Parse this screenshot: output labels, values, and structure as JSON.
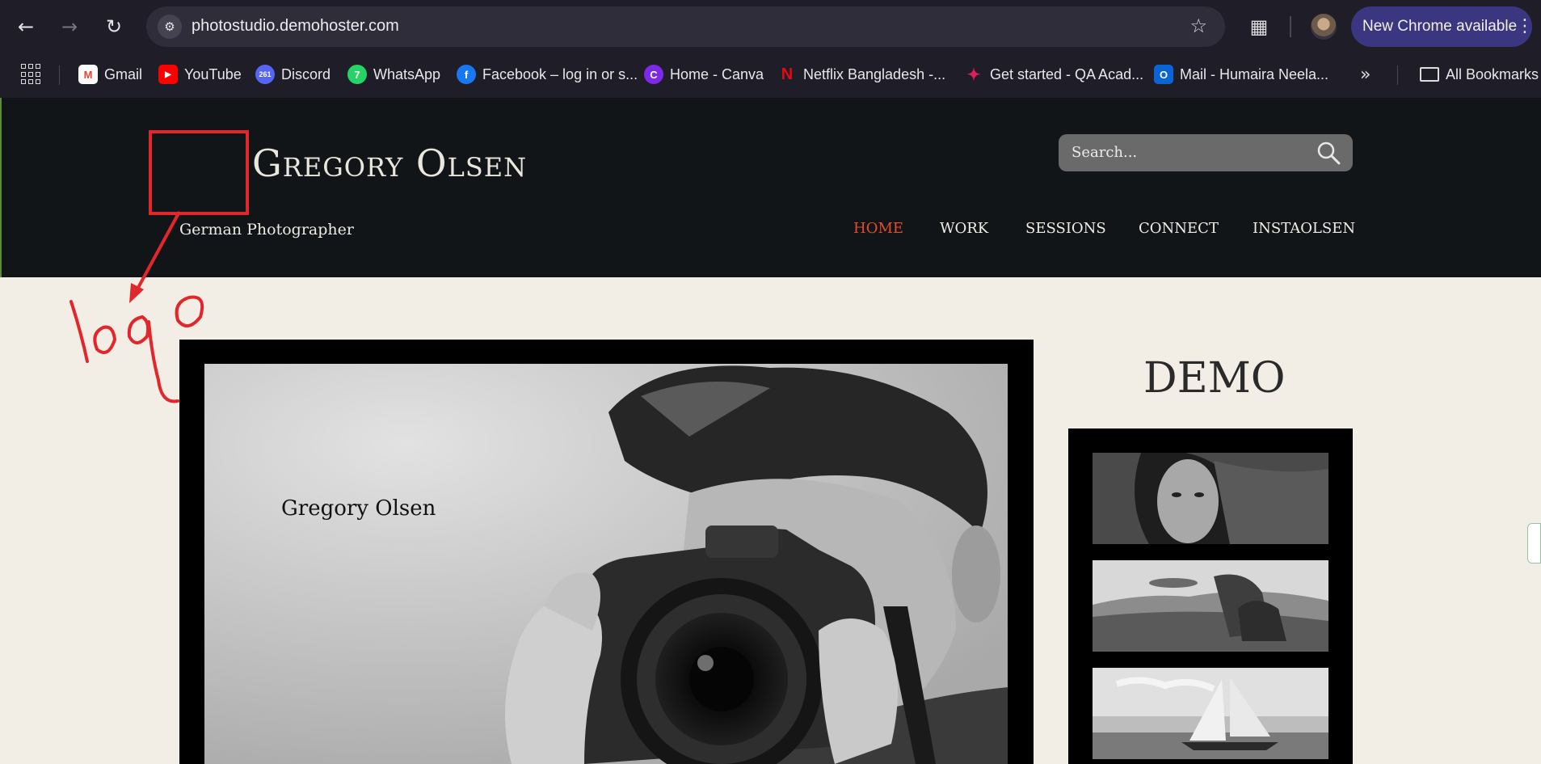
{
  "browser": {
    "url": "photostudio.demohoster.com",
    "update_label": "New Chrome available",
    "bookmarks": [
      {
        "label": "Gmail",
        "icon": "gmail-icon",
        "color": "#ea4335"
      },
      {
        "label": "YouTube",
        "icon": "youtube-icon",
        "color": "#ff0000"
      },
      {
        "label": "Discord",
        "icon": "discord-icon",
        "color": "#5865f2",
        "badge": "261"
      },
      {
        "label": "WhatsApp",
        "icon": "whatsapp-icon",
        "color": "#25d366",
        "badge": "7"
      },
      {
        "label": "Facebook – log in or s...",
        "icon": "facebook-icon",
        "color": "#1877f2"
      },
      {
        "label": "Home - Canva",
        "icon": "canva-icon",
        "color": "#7d2ae8"
      },
      {
        "label": "Netflix Bangladesh -...",
        "icon": "netflix-icon",
        "color": "#e50914"
      },
      {
        "label": "Get started - QA Acad...",
        "icon": "slack-icon",
        "color": "#e01e5a"
      },
      {
        "label": "Mail - Humaira Neela...",
        "icon": "outlook-icon",
        "color": "#0a64d6"
      }
    ],
    "all_bookmarks_label": "All Bookmarks"
  },
  "site": {
    "title": "Gregory Olsen",
    "tagline": "German Photographer",
    "search_placeholder": "Search...",
    "nav": [
      "HOME",
      "WORK",
      "SESSIONS",
      "CONNECT",
      "INSTAOLSEN"
    ],
    "active_nav": "HOME",
    "hero_caption": "Gregory Olsen",
    "sidebar_title": "DEMO"
  },
  "annotation": {
    "label": "logo",
    "color": "#e3262b"
  }
}
